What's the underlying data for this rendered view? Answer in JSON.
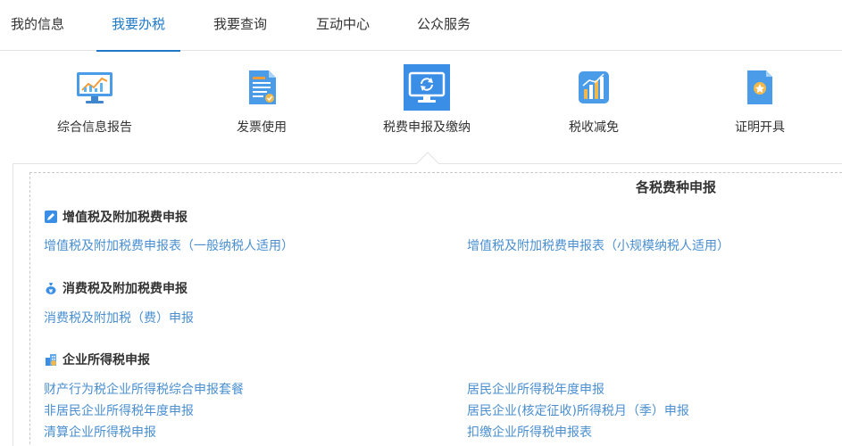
{
  "tabs": [
    {
      "label": "我的信息",
      "active": false
    },
    {
      "label": "我要办税",
      "active": true
    },
    {
      "label": "我要查询",
      "active": false
    },
    {
      "label": "互动中心",
      "active": false
    },
    {
      "label": "公众服务",
      "active": false
    }
  ],
  "functions": [
    {
      "label": "综合信息报告",
      "icon": "report-monitor-icon"
    },
    {
      "label": "发票使用",
      "icon": "invoice-document-icon"
    },
    {
      "label": "税费申报及缴纳",
      "icon": "declare-monitor-icon",
      "selected": true
    },
    {
      "label": "税收减免",
      "icon": "bar-chart-icon"
    },
    {
      "label": "证明开具",
      "icon": "certificate-icon"
    }
  ],
  "panel": {
    "title": "各税费种申报",
    "sections": [
      {
        "title": "增值税及附加税费申报",
        "icon": "edit-icon",
        "links": [
          "增值税及附加税费申报表（一般纳税人适用）",
          "增值税及附加税费申报表（小规模纳税人适用）"
        ]
      },
      {
        "title": "消费税及附加税费申报",
        "icon": "money-bag-icon",
        "links": [
          "消费税及附加税（费）申报"
        ]
      },
      {
        "title": "企业所得税申报",
        "icon": "enterprise-icon",
        "links": [
          "财产行为税企业所得税综合申报套餐",
          "居民企业所得税年度申报",
          "非居民企业所得税年度申报",
          "居民企业(核定征收)所得税月（季）申报",
          "清算企业所得税申报",
          "扣缴企业所得税申报表"
        ]
      }
    ]
  },
  "colors": {
    "accent": "#1f79c6",
    "link": "#4a8fd1",
    "selected_icon_bg": "#3a8ee6"
  }
}
